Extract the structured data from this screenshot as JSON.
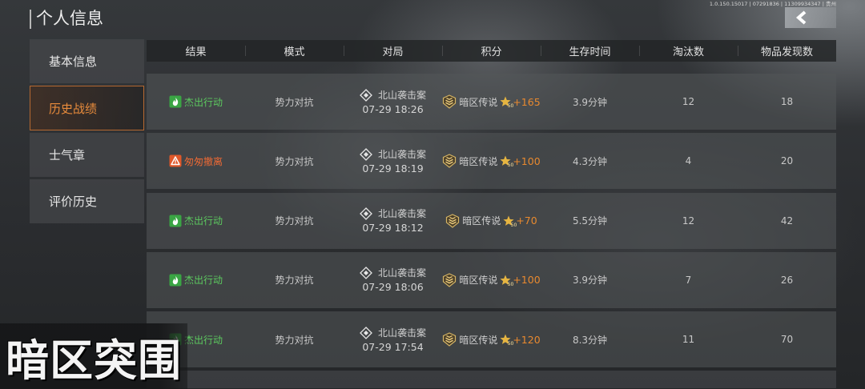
{
  "header": {
    "title": "个人信息",
    "build_info": "1.0.150.15017 | 07291836 | 11309934347 | 贵州",
    "back_icon": "chevron-left-icon"
  },
  "sidebar": {
    "items": [
      {
        "label": "基本信息",
        "active": false
      },
      {
        "label": "历史战绩",
        "active": true
      },
      {
        "label": "士气章",
        "active": false
      },
      {
        "label": "评价历史",
        "active": false
      }
    ]
  },
  "table": {
    "columns": [
      "结果",
      "模式",
      "对局",
      "积分",
      "生存时间",
      "淘汰数",
      "物品发现数"
    ],
    "rows": [
      {
        "result": "杰出行动",
        "result_icon": "flame-icon",
        "result_color": "#5cc95f",
        "mode": "势力对抗",
        "map_icon": "diamond-map-icon",
        "map": "北山袭击案",
        "time": "07-29 18:26",
        "rank_icon": "rank-emblem-icon",
        "rank": "暗区传说",
        "star_icon": "star-icon",
        "star_level": "50",
        "score": "+165",
        "survival": "3.9分钟",
        "eliminations": "12",
        "items_found": "18"
      },
      {
        "result": "匆匆撤离",
        "result_icon": "warning-icon",
        "result_color": "#ee6a35",
        "mode": "势力对抗",
        "map_icon": "diamond-map-icon",
        "map": "北山袭击案",
        "time": "07-29 18:19",
        "rank_icon": "rank-emblem-icon",
        "rank": "暗区传说",
        "star_icon": "star-icon",
        "star_level": "50",
        "score": "+100",
        "survival": "4.3分钟",
        "eliminations": "4",
        "items_found": "20"
      },
      {
        "result": "杰出行动",
        "result_icon": "flame-icon",
        "result_color": "#5cc95f",
        "mode": "势力对抗",
        "map_icon": "diamond-map-icon",
        "map": "北山袭击案",
        "time": "07-29 18:12",
        "rank_icon": "rank-emblem-icon",
        "rank": "暗区传说",
        "star_icon": "star-icon",
        "star_level": "50",
        "score": "+70",
        "survival": "5.5分钟",
        "eliminations": "12",
        "items_found": "42"
      },
      {
        "result": "杰出行动",
        "result_icon": "flame-icon",
        "result_color": "#5cc95f",
        "mode": "势力对抗",
        "map_icon": "diamond-map-icon",
        "map": "北山袭击案",
        "time": "07-29 18:06",
        "rank_icon": "rank-emblem-icon",
        "rank": "暗区传说",
        "star_icon": "star-icon",
        "star_level": "50",
        "score": "+100",
        "survival": "3.9分钟",
        "eliminations": "7",
        "items_found": "26"
      },
      {
        "result": "杰出行动",
        "result_icon": "flame-icon",
        "result_color": "#5cc95f",
        "mode": "势力对抗",
        "map_icon": "diamond-map-icon",
        "map": "北山袭击案",
        "time": "07-29 17:54",
        "rank_icon": "rank-emblem-icon",
        "rank": "暗区传说",
        "star_icon": "star-icon",
        "star_level": "50",
        "score": "+120",
        "survival": "8.3分钟",
        "eliminations": "11",
        "items_found": "70"
      }
    ]
  },
  "watermark": {
    "logo_text": "暗区突围"
  },
  "colors": {
    "accent": "#ea8c3c",
    "score_gain": "#e8892f",
    "rank_gold": "#d6b565",
    "success": "#5cc95f",
    "warning": "#ee6a35"
  }
}
